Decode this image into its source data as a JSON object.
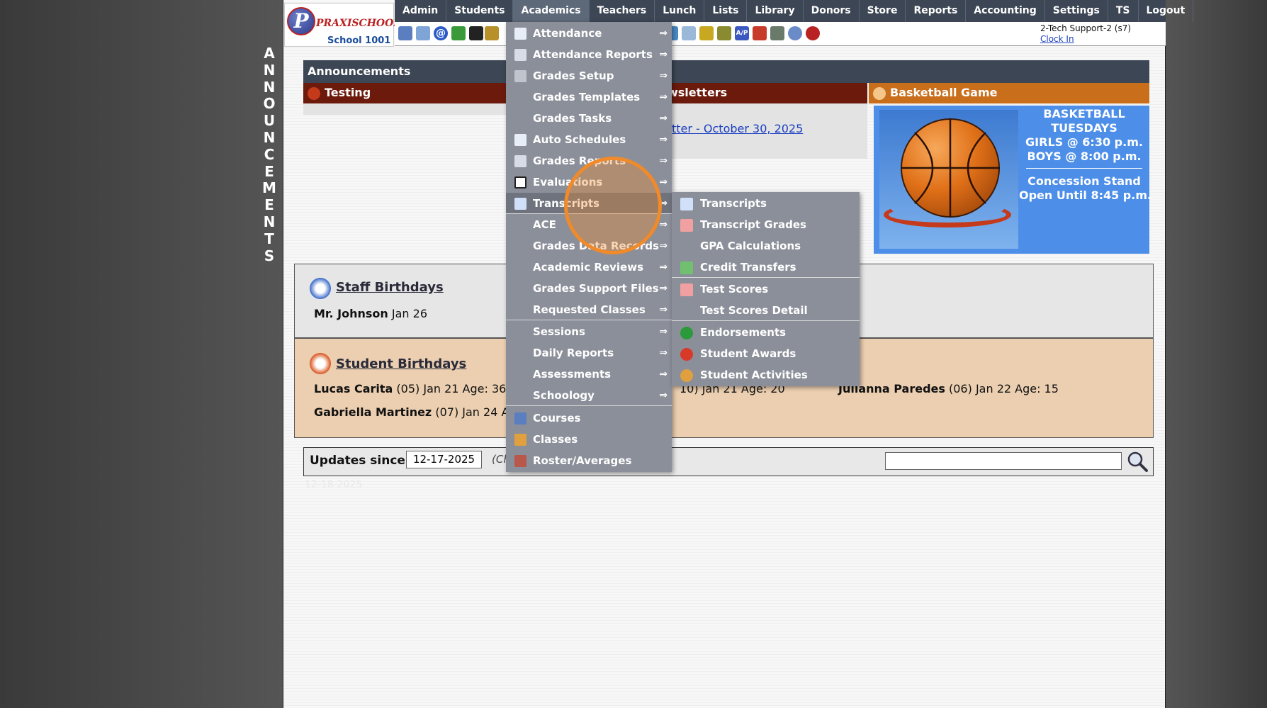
{
  "vertical_banner": [
    "A",
    "N",
    "N",
    "O",
    "U",
    "N",
    "C",
    "E",
    "M",
    "E",
    "N",
    "T",
    "S"
  ],
  "logo": {
    "letter": "P",
    "brand": "PRAXISCHOOL",
    "school": "School 1001"
  },
  "nav": {
    "items": [
      "Admin",
      "Students",
      "Academics",
      "Teachers",
      "Lunch",
      "Lists",
      "Library",
      "Donors",
      "Store",
      "Reports",
      "Accounting",
      "Settings",
      "TS",
      "Logout"
    ],
    "active": "Academics"
  },
  "toolbar": {
    "user": "2-Tech Support-2 (s7)",
    "clock_in": "Clock In",
    "icons": [
      "search-icon",
      "calendar-icon",
      "email-icon",
      "chat-icon",
      "phone-icon",
      "lunch-icon",
      "book-icon",
      "bell-icon",
      "notes-icon",
      "people-icon",
      "clock-icon",
      "grid-icon",
      "card-icon",
      "printer-icon",
      "ap-icon",
      "pdf-icon",
      "money-icon",
      "help-icon",
      "power-icon"
    ],
    "ap_text": "A/P"
  },
  "announcements": {
    "header": "Announcements",
    "testing": "Testing",
    "newsletters": "wsletters",
    "news_link": "tter - October 30, 2025",
    "basketball_title": "Basketball Game",
    "bball_lines": [
      "BASKETBALL",
      "TUESDAYS",
      "GIRLS @ 6:30 p.m.",
      "BOYS  @ 8:00 p.m."
    ],
    "bball_lines2": [
      "Concession Stand",
      "Open Until 8:45 p.m."
    ]
  },
  "staff_birthdays": {
    "title": "Staff Birthdays",
    "entries": [
      {
        "name": "Mr. Johnson",
        "detail": " Jan 26"
      }
    ]
  },
  "student_birthdays": {
    "title": "Student Birthdays",
    "row1": [
      {
        "name": "Lucas Carita",
        "detail": " (05) Jan 21 Age: 36"
      },
      {
        "name": "",
        "detail": "10) Jan 21 Age: 20"
      },
      {
        "name": "Julianna Paredes",
        "detail": " (06) Jan 22 Age: 15"
      }
    ],
    "row2": [
      {
        "name": "Gabriella Martinez",
        "detail": " (07) Jan 24 Ag"
      }
    ]
  },
  "updates": {
    "label": "Updates since:",
    "date": "12-17-2025",
    "hint": "(Ch",
    "ghost": "12-18-2025"
  },
  "academics_menu": {
    "items": [
      {
        "label": "Attendance",
        "icon": "calendar-icon",
        "arrow": "⇒"
      },
      {
        "label": "Attendance Reports",
        "icon": "printer-icon",
        "arrow": "⇒"
      },
      {
        "label": "Grades Setup",
        "icon": "gear-icon",
        "arrow": "⇒"
      },
      {
        "label": "Grades Templates",
        "icon": "",
        "arrow": "⇒"
      },
      {
        "label": "Grades Tasks",
        "icon": "",
        "arrow": "⇒"
      },
      {
        "label": "Auto Schedules",
        "icon": "calendar-icon",
        "arrow": "⇒"
      },
      {
        "label": "Grades Reports",
        "icon": "printer-icon",
        "arrow": "⇒"
      },
      {
        "label": "Evaluations",
        "icon": "checkbox-icon",
        "arrow": "⇒"
      },
      {
        "label": "Transcripts",
        "icon": "document-icon",
        "arrow": "⇒"
      },
      {
        "label": "ACE",
        "icon": "",
        "arrow": "⇒"
      },
      {
        "label": "Grades Data Records",
        "icon": "",
        "arrow": "⇒"
      },
      {
        "label": "Academic Reviews",
        "icon": "",
        "arrow": "⇒"
      },
      {
        "label": "Grades Support Files",
        "icon": "",
        "arrow": "⇒"
      },
      {
        "label": "Requested Classes",
        "icon": "",
        "arrow": "⇒"
      },
      {
        "label": "Sessions",
        "icon": "",
        "arrow": "⇒"
      },
      {
        "label": "Daily Reports",
        "icon": "",
        "arrow": "⇒"
      },
      {
        "label": "Assessments",
        "icon": "",
        "arrow": "⇒"
      },
      {
        "label": "Schoology",
        "icon": "",
        "arrow": "⇒"
      },
      {
        "label": "Courses",
        "icon": "book-icon",
        "arrow": ""
      },
      {
        "label": "Classes",
        "icon": "person-icon",
        "arrow": ""
      },
      {
        "label": "Roster/Averages",
        "icon": "roster-icon",
        "arrow": ""
      }
    ],
    "active": "Transcripts"
  },
  "transcripts_submenu": {
    "items": [
      {
        "label": "Transcripts",
        "icon": "document-icon"
      },
      {
        "label": "Transcript Grades",
        "icon": "a-plus-icon"
      },
      {
        "label": "GPA Calculations",
        "icon": ""
      },
      {
        "label": "Credit Transfers",
        "icon": "transfer-icon"
      },
      {
        "label": "Test Scores",
        "icon": "a-plus-icon"
      },
      {
        "label": "Test Scores Detail",
        "icon": ""
      },
      {
        "label": "Endorsements",
        "icon": "checkmark-icon"
      },
      {
        "label": "Student Awards",
        "icon": "ribbon-icon"
      },
      {
        "label": "Student Activities",
        "icon": "person-icon"
      }
    ]
  },
  "colors": {
    "nav_bg": "#3c4654",
    "menu_bg": "#8b8f99",
    "highlight": "#f08a2a",
    "testing_bar": "#6b1a0c",
    "bball_bar": "#c96f1c",
    "bball_box": "#4d8fe8"
  }
}
